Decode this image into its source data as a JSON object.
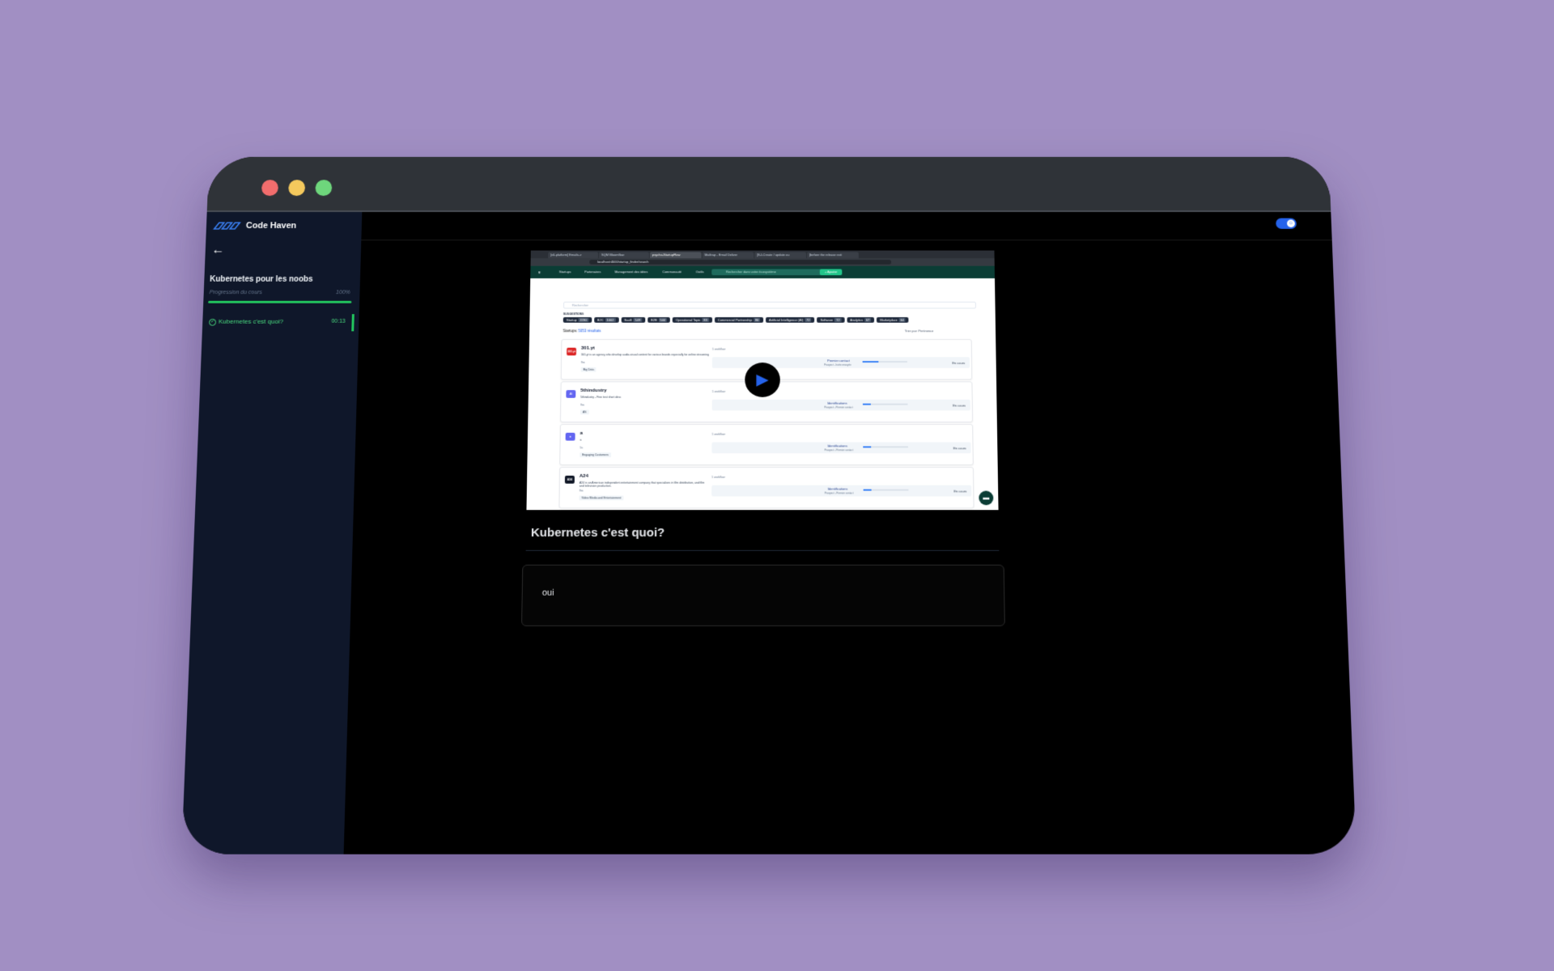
{
  "app": {
    "brand": "Code Haven"
  },
  "sidebar": {
    "back_label": "←",
    "course_title": "Kubernetes pour les noobs",
    "progress_label": "Progression du cours",
    "progress_percent": "100%",
    "progress_value": 1.0,
    "lessons": [
      {
        "label": "Kubernetes c'est quoi?",
        "duration": "00:13",
        "completed": true
      }
    ]
  },
  "video": {
    "browser_tabs": [
      "[v0-platform] Emails-v",
      "SQM Bloomflow",
      "psycho-StartupFlow",
      "Mailtrap - Email Deliver",
      "[S-I-Create / update ou",
      "[before the release exit"
    ],
    "url": "localhost:4000/startup_finder/search",
    "nav": {
      "items": [
        "Startups",
        "Partenaires",
        "Management des idées",
        "Communauté",
        "Outils"
      ],
      "search_placeholder": "Rechercher dans votre écosystème",
      "add_label": "+ Ajouter"
    },
    "search_placeholder": "Rechercher",
    "suggestions_label": "SUGGESTIONS",
    "chips": [
      {
        "label": "Startup",
        "count": "2230"
      },
      {
        "label": "B2C",
        "count": "1002"
      },
      {
        "label": "SaaS",
        "count": "549"
      },
      {
        "label": "B2B",
        "count": "544"
      },
      {
        "label": "Operational Topic",
        "count": "83"
      },
      {
        "label": "Commercial Partnership",
        "count": "80"
      },
      {
        "label": "Artificial Intelligence (AI)",
        "count": "72"
      },
      {
        "label": "Software",
        "count": "72"
      },
      {
        "label": "Analytics",
        "count": "67"
      },
      {
        "label": "Marketplace",
        "count": "64"
      }
    ],
    "results_prefix": "Startups:",
    "results_count": "5053 résultats",
    "sort_label": "Trier par: Pertinence",
    "cards": [
      {
        "logo": "301.yt",
        "name": "301.yt",
        "desc": "301.yt is an agency who develop audio-visual content for various brands especially for online streaming",
        "time": "9m",
        "tag": "Big Data",
        "workflow": "1 workflow",
        "stage": "Premier contact",
        "stage_sub": "Prospect - Invite envoyée",
        "status": "En cours",
        "progress": 0.35
      },
      {
        "logo": "4i",
        "name": "5thindustry",
        "desc": "5thindustry - Fine test short desc",
        "time": "9m",
        "tag": "AS",
        "workflow": "1 workflow",
        "stage": "Identifications",
        "stage_sub": "Prospect - Premier contact",
        "status": "En cours",
        "progress": 0.18
      },
      {
        "logo": "a",
        "name": "a",
        "desc": "a",
        "time": "5s",
        "tag": "Engaging Customers",
        "workflow": "1 workflow",
        "stage": "Identifications",
        "stage_sub": "Prospect - Premier contact",
        "status": "En cours",
        "progress": 0.18
      },
      {
        "logo": "A24",
        "name": "A24",
        "desc": "A24 is an American independent entertainment company that specializes in film distribution, and film and television production.",
        "time": "9m",
        "tag": "Video   Media and Entertainment",
        "workflow": "1 workflow",
        "stage": "Identifications",
        "stage_sub": "Prospect - Premier contact",
        "status": "En cours",
        "progress": 0.18
      }
    ]
  },
  "main": {
    "lesson_title": "Kubernetes c'est quoi?",
    "note_text": "oui"
  },
  "colors": {
    "accent_green": "#22c55e",
    "accent_blue": "#2563eb",
    "sidebar_bg": "#0f172a",
    "page_bg": "#a18fc3"
  }
}
